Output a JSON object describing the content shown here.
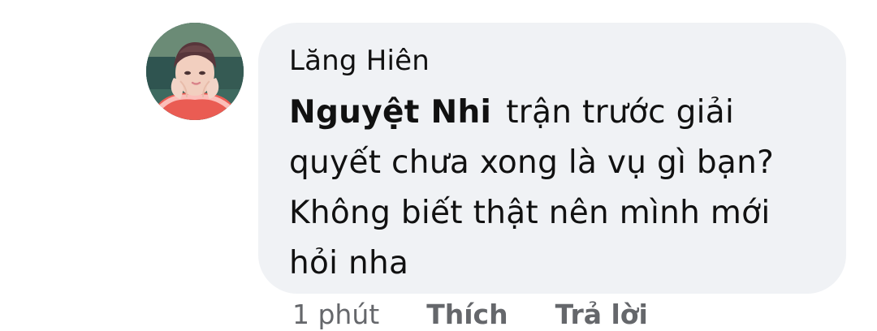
{
  "comment": {
    "author": "Lăng Hiên",
    "mention": "Nguyệt Nhi",
    "text": "trận trước giải quyết chưa xong là vụ gì bạn? Không biết thật nên mình mới hỏi nha",
    "time": "1 phút",
    "like_label": "Thích",
    "reply_label": "Trả lời"
  },
  "colors": {
    "bubble": "#f0f2f5",
    "text": "#111111",
    "meta": "#65676b"
  },
  "icons": {
    "avatar": "user-avatar"
  }
}
